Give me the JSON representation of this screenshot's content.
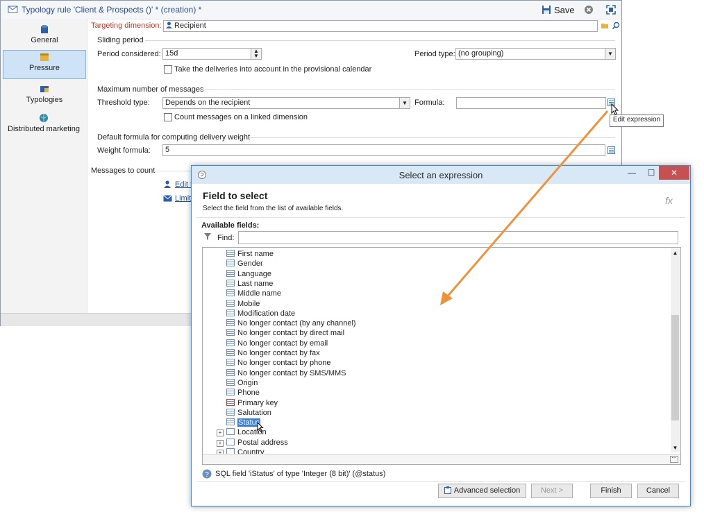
{
  "window": {
    "title": "Typology rule 'Client & Prospects ()' * (creation) *",
    "save_label": "Save"
  },
  "sidebar": {
    "items": [
      {
        "label": "General"
      },
      {
        "label": "Pressure"
      },
      {
        "label": "Typologies"
      },
      {
        "label": "Distributed marketing"
      }
    ]
  },
  "form": {
    "targeting_label": "Targeting dimension:",
    "targeting_value": "Recipient",
    "sliding_period_title": "Sliding period",
    "period_considered_label": "Period considered:",
    "period_considered_value": "15d",
    "period_type_label": "Period type:",
    "period_type_value": "(no grouping)",
    "provisional_label": "Take the deliveries into account in the provisional calendar",
    "max_messages_title": "Maximum number of messages",
    "threshold_type_label": "Threshold type:",
    "threshold_type_value": "Depends on the recipient",
    "formula_label": "Formula:",
    "formula_value": "",
    "count_linked_label": "Count messages on a linked dimension",
    "default_formula_title": "Default formula for computing delivery weight",
    "weight_formula_label": "Weight formula:",
    "weight_formula_value": "5",
    "messages_to_count_title": "Messages to count",
    "link1": "Edit t",
    "link2": "Limit"
  },
  "tooltip": "Edit expression",
  "dialog": {
    "title": "Select an expression",
    "heading": "Field to select",
    "subheading": "Select the field from the list of available fields.",
    "fx": "fx",
    "available_label": "Available fields:",
    "find_label": "Find:",
    "find_value": "",
    "fields": [
      "First name",
      "Gender",
      "Language",
      "Last name",
      "Middle name",
      "Mobile",
      "Modification date",
      "No longer contact (by any channel)",
      "No longer contact by direct mail",
      "No longer contact by email",
      "No longer contact by fax",
      "No longer contact by phone",
      "No longer contact by SMS/MMS",
      "Origin",
      "Phone",
      "Primary key",
      "Salutation",
      "Status"
    ],
    "groups": [
      "Location",
      "Postal address",
      "Country"
    ],
    "selected": "Status",
    "info": "SQL field 'iStatus' of type 'Integer (8 bit)' (@status)",
    "buttons": {
      "advanced": "Advanced selection",
      "next": "Next >",
      "finish": "Finish",
      "cancel": "Cancel"
    }
  },
  "colors": {
    "accent": "#3a7fd5",
    "required": "#c0392b",
    "arrow": "#f0923a"
  }
}
